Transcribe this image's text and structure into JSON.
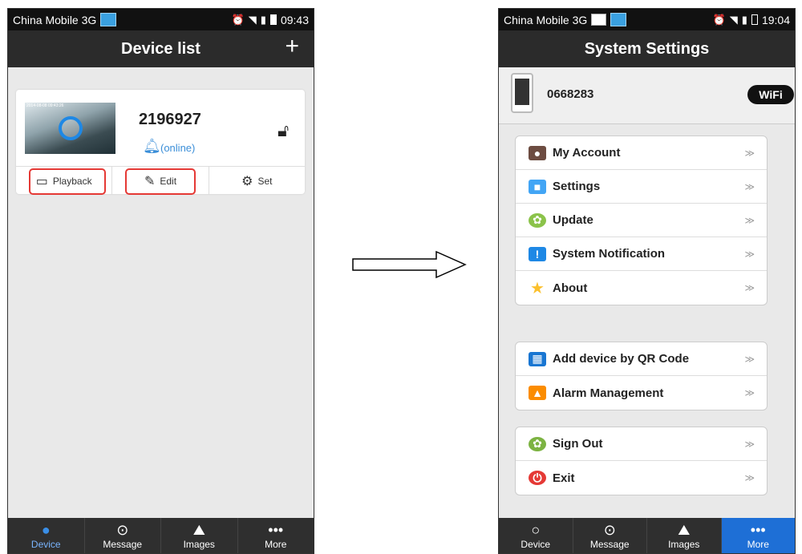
{
  "screen1": {
    "status": {
      "carrier": "China Mobile 3G",
      "time": "09:43"
    },
    "title": "Device list",
    "add_label": "+",
    "device": {
      "id": "2196927",
      "status": "(online)",
      "thumb_stamp": "2014-08-08 09:43:26"
    },
    "actions": [
      {
        "label": "Playback"
      },
      {
        "label": "Edit"
      },
      {
        "label": "Set"
      }
    ],
    "tabs": [
      {
        "label": "Device"
      },
      {
        "label": "Message"
      },
      {
        "label": "Images"
      },
      {
        "label": "More"
      }
    ]
  },
  "screen2": {
    "status": {
      "carrier": "China Mobile 3G",
      "time": "19:04"
    },
    "title": "System Settings",
    "user_id": "0668283",
    "wifi_label": "WiFi",
    "group1": [
      {
        "label": "My Account"
      },
      {
        "label": "Settings"
      },
      {
        "label": "Update"
      },
      {
        "label": "System Notification"
      },
      {
        "label": "About"
      }
    ],
    "group2": [
      {
        "label": "Add device by QR Code"
      },
      {
        "label": "Alarm Management"
      }
    ],
    "group3": [
      {
        "label": "Sign Out"
      },
      {
        "label": "Exit"
      }
    ],
    "chevron": "≫",
    "tabs": [
      {
        "label": "Device"
      },
      {
        "label": "Message"
      },
      {
        "label": "Images"
      },
      {
        "label": "More"
      }
    ]
  },
  "colors": {
    "highlight": "#e53935",
    "accent": "#1e6fd6",
    "online": "#3a8ed8"
  }
}
